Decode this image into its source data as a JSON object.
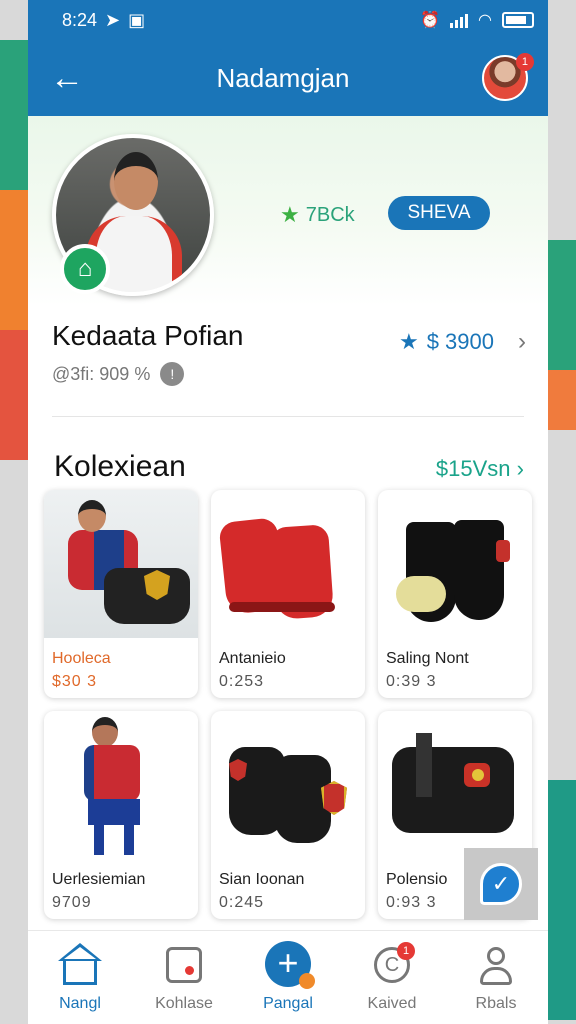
{
  "status_bar": {
    "time": "8:24",
    "left_icons": [
      "send-icon",
      "image-icon"
    ],
    "right_icons": [
      "alarm-icon",
      "signal-icon",
      "wifi-icon",
      "battery-icon"
    ]
  },
  "app_bar": {
    "title": "Nadamgjan",
    "back_icon": "arrow-left-icon",
    "avatar_badge": "1"
  },
  "profile": {
    "rating_text": "7BCk",
    "action_button": "SHEVA",
    "name": "Kedaata Pofian",
    "sub_info": "@3fi: 909 %",
    "price_link": "$ 3900",
    "badge_icon": "leaf-icon"
  },
  "collection": {
    "title": "Kolexiean",
    "link": "$15Vsn",
    "items": [
      {
        "title": "Hooleca",
        "price": "$30 3",
        "accent": "#e0692a"
      },
      {
        "title": "Antanieio",
        "price": "0:253"
      },
      {
        "title": "Saling Nont",
        "price": "0:39 3"
      },
      {
        "title": "Uerlesiemian",
        "price": "9709"
      },
      {
        "title": "Sian Ioonan",
        "price": "0:245"
      },
      {
        "title": "Polensio",
        "price": "0:93 3"
      }
    ]
  },
  "nav": {
    "items": [
      {
        "label": "Nangl",
        "icon": "home-icon",
        "active": true
      },
      {
        "label": "Kohlase",
        "icon": "collection-icon"
      },
      {
        "label": "Pangal",
        "icon": "add-icon"
      },
      {
        "label": "Kaived",
        "icon": "ranked-icon",
        "badge": "1"
      },
      {
        "label": "Rbals",
        "icon": "profile-icon"
      }
    ]
  },
  "colors": {
    "primary": "#1a75b8",
    "accent_green": "#2aa27a",
    "accent_orange": "#e0692a"
  }
}
